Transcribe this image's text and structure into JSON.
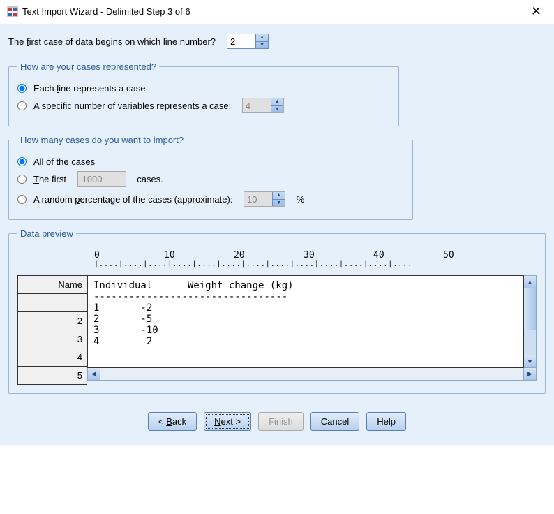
{
  "window": {
    "title": "Text Import Wizard - Delimited Step 3 of 6"
  },
  "first_line": {
    "label_pre": "The ",
    "label_u": "f",
    "label_post": "irst case of data begins on which line number?",
    "value": "2"
  },
  "cases_repr": {
    "legend": "How are your cases represented?",
    "opt1_pre": "Each ",
    "opt1_u": "l",
    "opt1_post": "ine represents a case",
    "opt2_pre": "A specific number of ",
    "opt2_u": "v",
    "opt2_post": "ariables represents a case:",
    "vars_value": "4"
  },
  "import_count": {
    "legend": "How many cases do you want to import?",
    "opt_all_u": "A",
    "opt_all_post": "ll of the cases",
    "opt_first_u": "T",
    "opt_first_mid": "he first",
    "opt_first_value": "1000",
    "opt_first_after": "cases.",
    "opt_pct_pre": "A random ",
    "opt_pct_u": "p",
    "opt_pct_post": "ercentage of the cases (approximate):",
    "pct_value": "10",
    "pct_sym": "%"
  },
  "preview": {
    "legend": "Data preview",
    "ruler": [
      "0",
      "10",
      "20",
      "30",
      "40",
      "50"
    ],
    "row_labels": [
      "Name",
      "",
      "2",
      "3",
      "4",
      "5"
    ],
    "data_lines": [
      "Individual      Weight change (kg)",
      "---------------------------------",
      "1       -2",
      "2       -5",
      "3       -10",
      "4        2"
    ]
  },
  "buttons": {
    "back_pre": "< ",
    "back_u": "B",
    "back_post": "ack",
    "next_u": "N",
    "next_post": "ext >",
    "finish": "Finish",
    "cancel": "Cancel",
    "help": "Help"
  }
}
